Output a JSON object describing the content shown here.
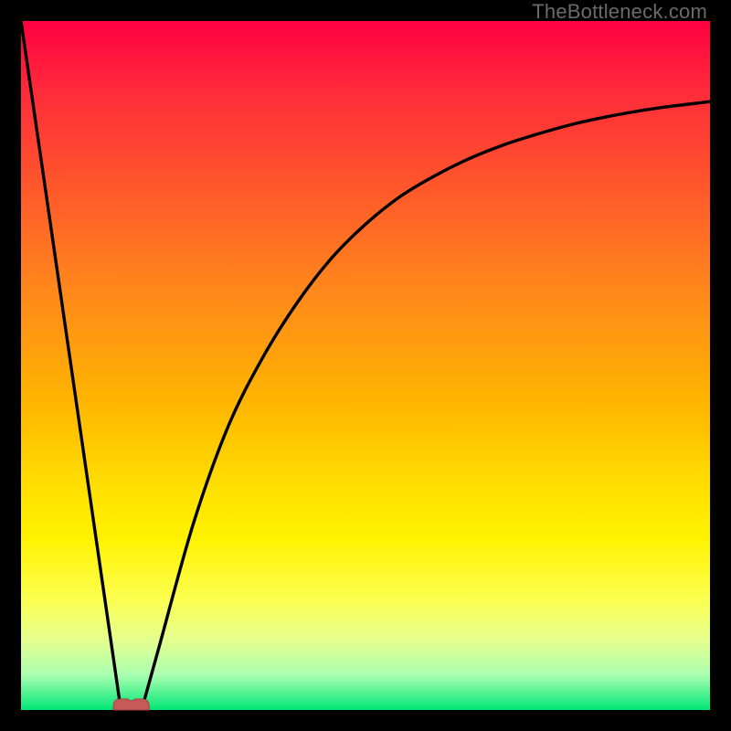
{
  "watermark": "TheBottleneck.com",
  "colors": {
    "frame": "#000000",
    "gradient_top": "#ff0040",
    "gradient_bottom": "#00e676",
    "curve": "#000000",
    "marker_fill": "#c65a5a",
    "marker_stroke": "#a84242"
  },
  "chart_data": {
    "type": "line",
    "title": "",
    "xlabel": "",
    "ylabel": "",
    "xlim": [
      0,
      100
    ],
    "ylim": [
      0,
      100
    ],
    "grid": false,
    "legend": false,
    "annotations": [],
    "series": [
      {
        "name": "left-branch",
        "x": [
          0,
          14.5
        ],
        "values": [
          100,
          0
        ]
      },
      {
        "name": "right-branch",
        "x": [
          17.5,
          20,
          25,
          30,
          35,
          40,
          45,
          50,
          55,
          60,
          65,
          70,
          75,
          80,
          85,
          90,
          95,
          100
        ],
        "values": [
          0,
          9,
          27,
          41,
          51,
          59,
          65.5,
          70.5,
          74.5,
          77.5,
          80,
          82,
          83.6,
          85,
          86.1,
          87,
          87.7,
          88.3
        ]
      }
    ],
    "marker": {
      "name": "minimum-marker",
      "x_range": [
        13.4,
        18.6
      ],
      "y": 0,
      "shape": "rounded-bar"
    }
  }
}
